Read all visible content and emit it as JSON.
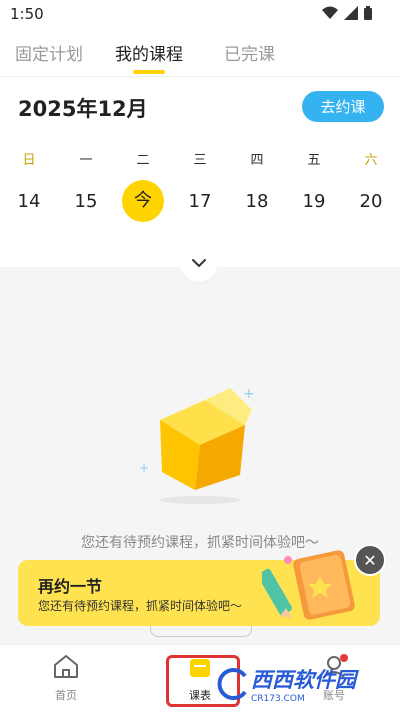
{
  "status": {
    "time": "1:50"
  },
  "tabs": [
    {
      "label": "固定计划"
    },
    {
      "label": "我的课程",
      "active": true
    },
    {
      "label": "已完课"
    }
  ],
  "calendar": {
    "month": "2025年12月",
    "book_button": "去约课",
    "weekdays": [
      "日",
      "一",
      "二",
      "三",
      "四",
      "五",
      "六"
    ],
    "dates": [
      "14",
      "15",
      "今",
      "17",
      "18",
      "19",
      "20"
    ]
  },
  "empty": {
    "text": "您还有待预约课程，抓紧时间体验吧～"
  },
  "promo": {
    "title": "再约一节",
    "subtitle": "您还有待预约课程，抓紧时间体验吧～"
  },
  "bottom_nav": [
    {
      "label": "首页",
      "icon": "home-icon"
    },
    {
      "label": "课表",
      "icon": "schedule-icon"
    },
    {
      "label": "账号",
      "icon": "account-icon"
    }
  ],
  "watermark": {
    "text": "西西软件园",
    "sub": "CR173.COM"
  },
  "colors": {
    "accent": "#ffd400",
    "button_blue": "#35b2f0",
    "promo_bg": "#ffe24f"
  }
}
